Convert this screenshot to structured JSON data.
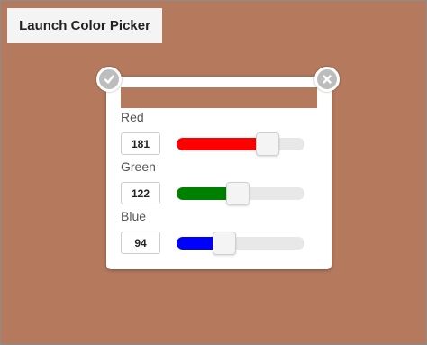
{
  "launch_button": {
    "label": "Launch Color Picker"
  },
  "background_color": "#b57a5e",
  "picker": {
    "swatch_color": "#b57a5e",
    "confirm_icon": "check-icon",
    "close_icon": "close-icon",
    "channels": [
      {
        "label": "Red",
        "value": "181",
        "fraction": 0.71,
        "color": "#ff0000"
      },
      {
        "label": "Green",
        "value": "122",
        "fraction": 0.48,
        "color": "#008000"
      },
      {
        "label": "Blue",
        "value": "94",
        "fraction": 0.37,
        "color": "#0000ff"
      }
    ]
  }
}
